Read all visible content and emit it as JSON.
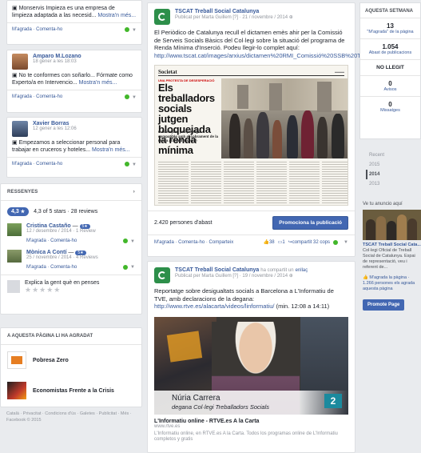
{
  "left_posts": [
    {
      "text": "Monservis Impieza es una empresa de limpieza adaptada a las necesid...",
      "more": "Mostra'n més...",
      "actions": [
        "M'agrada",
        "Comenta-ho"
      ]
    },
    {
      "name": "Amparo M.Lozano",
      "time": "18 gener a les 18:03",
      "text": "No te conformes con soñarlo... Fórmate como Experto/a en Intervencio...",
      "more": "Mostra'n més...",
      "actions": [
        "M'agrada",
        "Comenta-ho"
      ]
    },
    {
      "name": "Xavier Borras",
      "time": "12 gener a les 12:06",
      "text": "Empezamos a seleccionar personal para trabajar en cruceros y hoteles...",
      "more": "Mostra'n més...",
      "actions": [
        "M'agrada",
        "Comenta-ho"
      ]
    }
  ],
  "reviews": {
    "title": "RESSENYES",
    "rating": "4,3",
    "summary": "4,3 of 5 stars · 28 reviews",
    "items": [
      {
        "name": "Cristina Castaño",
        "badge": "5★",
        "meta": "12 / desembre / 2014 · 1 Review",
        "actions": [
          "M'agrada",
          "Comenta-ho"
        ]
      },
      {
        "name": "Mònica A Contí",
        "badge": "5★",
        "meta": "25 / novembre / 2014 · 4 Reviews",
        "actions": [
          "M'agrada",
          "Comenta-ho"
        ]
      }
    ],
    "explain": "Explica la gent què en penses"
  },
  "liked": {
    "title": "A AQUESTA PÀGINA LI HA AGRADAT",
    "items": [
      "Pobresa Zero",
      "Economistas Frente a la Crisis"
    ]
  },
  "footer": "Català · Privacitat · Condicions d'ús · Galetes · Publicitat · Més · Facebook © 2015",
  "post1": {
    "page": "TSCAT Treball Social Catalunya",
    "meta": "Publicat per Marta Guillem [?] · 21 / novembre / 2014",
    "text": "El Periòdico de Catalunya recull el dictamen emès ahir per la Comissió de Serveis Socials Bàsics del Col·legi sobre la situació del programa de Renda Mínima d'Inserció. Podeu llegir-lo complet aquí:",
    "url": "http://www.tscat.cat/images/arxius/dictamen%20RMI_Comissió%20SSB%20TSCAT_nov2014.pdf",
    "newspaper": {
      "masthead": "Societat",
      "kicker": "UNA PROTESTA DE DESESPERACIÓ",
      "headline": "Els treballadors socials jutgen bloquejada la renda mínima",
      "sub": "Advoquen perquè sigui compatible amb el cobrament de la renda activa d'inserció"
    },
    "reach": "2.420 persones d'abast",
    "promote": "Promociona la publicació",
    "actions": [
      "M'agrada",
      "Comenta-ho",
      "Comparteix"
    ],
    "likes": "38",
    "comments": "1",
    "shares": "32 cops"
  },
  "post2": {
    "page": "TSCAT Treball Social Catalunya",
    "shared": "ha compartit un",
    "shared_what": "enllaç",
    "meta": "Publicat per Marta Guillem [?] · 19 / novembre / 2014",
    "text": "Reportatge sobre desigualtats socials a Barcelona a L'Informatiu de TVE, amb declaracions de la degana:",
    "url": "http://www.rtve.es/alacarta/videos/linformatiu/",
    "url_suffix": "(min. 12:08 a 14:11)",
    "video_name": "Núria Carrera",
    "video_role": "degana Col·legi Treballadors Socials",
    "channel": "2",
    "link_title": "L'Informatiu online - RTVE.es A la Carta",
    "link_domain": "www.rtve.es",
    "link_desc": "L'Informatiu online, en RTVE.es A la Carta. Todos los programas online de L'Informatiu completos y gratis"
  },
  "week": {
    "title": "AQUESTA SETMANA",
    "stats": [
      {
        "num": "13",
        "label": "\"M'agrada\" de la pàgina"
      },
      {
        "num": "1.054",
        "label": "Abast de publicacions"
      }
    ],
    "unread": "NO LLEGIT",
    "stats2": [
      {
        "num": "0",
        "label": "Avisos"
      },
      {
        "num": "0",
        "label": "Missatges"
      }
    ]
  },
  "years": [
    "Recent",
    "2015",
    "2014",
    "2013"
  ],
  "ad": {
    "title": "Ve tu anuncio aquí",
    "name": "TSCAT Treball Social Cata...",
    "desc": "Col·legi Oficial de Treball Social de Catalunya. Espai de representació, veu i referent de...",
    "like": "M'agrada la pàgina · 1.266 persones els agrada aquesta pàgina",
    "button": "Promote Page"
  },
  "colors": {
    "fb_blue": "#4267b2",
    "link": "#365899",
    "green": "#2d8f4a"
  }
}
